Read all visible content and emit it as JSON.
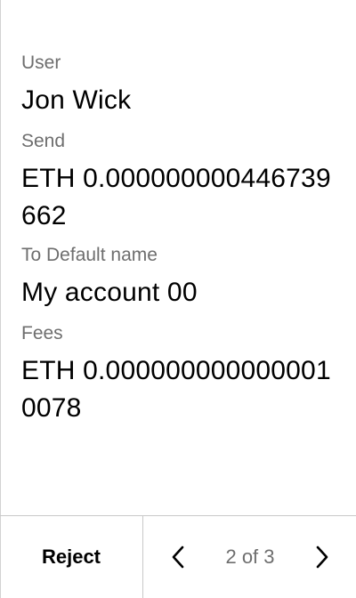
{
  "fields": {
    "user_label": "User",
    "user_value": "Jon Wick",
    "send_label": "Send",
    "send_value": "ETH 0.000000000446739662",
    "to_label": "To Default name",
    "to_value": "My account 00",
    "fees_label": "Fees",
    "fees_value": "ETH 0.0000000000000010078"
  },
  "footer": {
    "reject_label": "Reject",
    "page_indicator": "2 of 3",
    "prev_icon": "chevron-left-icon",
    "next_icon": "chevron-right-icon"
  }
}
